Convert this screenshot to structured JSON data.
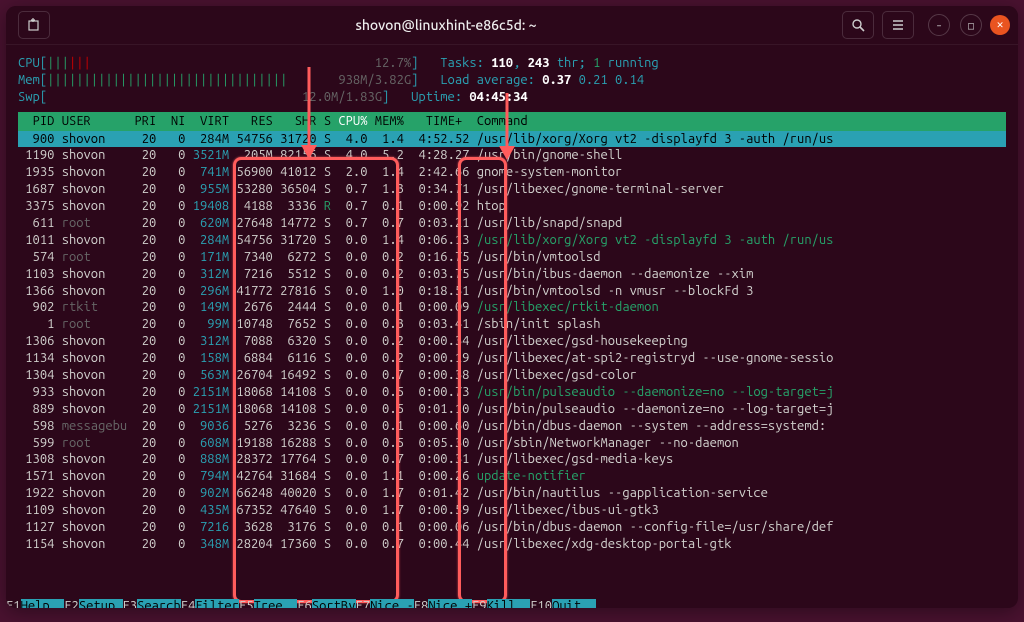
{
  "titlebar": {
    "title": "shovon@linuxhint-e86c5d: ~"
  },
  "meters": {
    "cpu_label": "CPU",
    "cpu_pct": "12.7%",
    "mem_label": "Mem",
    "mem_used": "938M",
    "mem_total": "3.82G",
    "swp_label": "Swp",
    "swp_used": "12.0M",
    "swp_total": "1.83G",
    "tasks_label": "Tasks:",
    "tasks_count": "110",
    "thr_count": "243",
    "thr_label": "thr;",
    "running": "1",
    "running_label": "running",
    "la_label": "Load average:",
    "la1": "0.37",
    "la2": "0.21",
    "la3": "0.14",
    "uptime_label": "Uptime:",
    "uptime": "04:45:34"
  },
  "hdr": {
    "pid": "PID",
    "user": "USER",
    "pri": "PRI",
    "ni": "NI",
    "virt": "VIRT",
    "res": "RES",
    "shr": "SHR",
    "s": "S",
    "cpu": "CPU%",
    "mem": "MEM%",
    "time": "TIME+",
    "cmd": "Command"
  },
  "rows": [
    {
      "pid": "900",
      "user": "shovon",
      "pri": "20",
      "ni": "0",
      "virt": "284M",
      "res": "54756",
      "shr": "31720",
      "s": "S",
      "cpu": "4.0",
      "mem": "1.4",
      "time": "4:52.52",
      "cmd": "/usr/lib/xorg/Xorg vt2 -displayfd 3 -auth /run/us",
      "sel": true
    },
    {
      "pid": "1190",
      "user": "shovon",
      "pri": "20",
      "ni": "0",
      "virt": "3521M",
      "res": "205M",
      "shr": "82156",
      "s": "S",
      "cpu": "4.0",
      "mem": "5.2",
      "time": "4:28.27",
      "cmd": "/usr/bin/gnome-shell"
    },
    {
      "pid": "1935",
      "user": "shovon",
      "pri": "20",
      "ni": "0",
      "virt": "741M",
      "res": "56900",
      "shr": "41012",
      "s": "S",
      "cpu": "2.0",
      "mem": "1.4",
      "time": "2:42.66",
      "cmd": "gnome-system-monitor"
    },
    {
      "pid": "1687",
      "user": "shovon",
      "pri": "20",
      "ni": "0",
      "virt": "955M",
      "res": "53280",
      "shr": "36504",
      "s": "S",
      "cpu": "0.7",
      "mem": "1.3",
      "time": "0:34.71",
      "cmd": "/usr/libexec/gnome-terminal-server"
    },
    {
      "pid": "3375",
      "user": "shovon",
      "pri": "20",
      "ni": "0",
      "virt": "19408",
      "res": "4188",
      "shr": "3336",
      "s": "R",
      "cpu": "0.7",
      "mem": "0.1",
      "time": "0:00.92",
      "cmd": "htop",
      "s_green": true
    },
    {
      "pid": "611",
      "user": "root",
      "user_gray": true,
      "pri": "20",
      "ni": "0",
      "virt": "620M",
      "res": "27648",
      "shr": "14772",
      "s": "S",
      "cpu": "0.7",
      "mem": "0.7",
      "time": "0:03.21",
      "cmd": "/usr/lib/snapd/snapd"
    },
    {
      "pid": "1011",
      "user": "shovon",
      "pri": "20",
      "ni": "0",
      "virt": "284M",
      "res": "54756",
      "shr": "31720",
      "s": "S",
      "cpu": "0.0",
      "mem": "1.4",
      "time": "0:06.13",
      "cmd": "/usr/lib/xorg/Xorg vt2 -displayfd 3 -auth /run/us",
      "cmd_green": true
    },
    {
      "pid": "574",
      "user": "root",
      "user_gray": true,
      "pri": "20",
      "ni": "0",
      "virt": "171M",
      "res": "7340",
      "shr": "6272",
      "s": "S",
      "cpu": "0.0",
      "mem": "0.2",
      "time": "0:16.75",
      "cmd": "/usr/bin/vmtoolsd"
    },
    {
      "pid": "1103",
      "user": "shovon",
      "pri": "20",
      "ni": "0",
      "virt": "312M",
      "res": "7216",
      "shr": "5512",
      "s": "S",
      "cpu": "0.0",
      "mem": "0.2",
      "time": "0:03.75",
      "cmd": "/usr/bin/ibus-daemon --daemonize --xim"
    },
    {
      "pid": "1366",
      "user": "shovon",
      "pri": "20",
      "ni": "0",
      "virt": "296M",
      "res": "41772",
      "shr": "27816",
      "s": "S",
      "cpu": "0.0",
      "mem": "1.0",
      "time": "0:18.51",
      "cmd": "/usr/bin/vmtoolsd -n vmusr --blockFd 3"
    },
    {
      "pid": "902",
      "user": "rtkit",
      "user_gray": true,
      "pri": "20",
      "ni": "0",
      "virt": "149M",
      "res": "2676",
      "shr": "2444",
      "s": "S",
      "cpu": "0.0",
      "mem": "0.1",
      "time": "0:00.09",
      "cmd": "/usr/libexec/rtkit-daemon",
      "cmd_green": true
    },
    {
      "pid": "1",
      "user": "root",
      "user_gray": true,
      "pri": "20",
      "ni": "0",
      "virt": "99M",
      "res": "10748",
      "shr": "7652",
      "s": "S",
      "cpu": "0.0",
      "mem": "0.3",
      "time": "0:03.41",
      "cmd": "/sbin/init splash"
    },
    {
      "pid": "1306",
      "user": "shovon",
      "pri": "20",
      "ni": "0",
      "virt": "312M",
      "res": "7088",
      "shr": "6320",
      "s": "S",
      "cpu": "0.0",
      "mem": "0.2",
      "time": "0:00.34",
      "cmd": "/usr/libexec/gsd-housekeeping"
    },
    {
      "pid": "1134",
      "user": "shovon",
      "pri": "20",
      "ni": "0",
      "virt": "158M",
      "res": "6884",
      "shr": "6116",
      "s": "S",
      "cpu": "0.0",
      "mem": "0.2",
      "time": "0:00.19",
      "cmd": "/usr/libexec/at-spi2-registryd --use-gnome-sessio"
    },
    {
      "pid": "1304",
      "user": "shovon",
      "pri": "20",
      "ni": "0",
      "virt": "563M",
      "res": "26704",
      "shr": "16492",
      "s": "S",
      "cpu": "0.0",
      "mem": "0.7",
      "time": "0:00.38",
      "cmd": "/usr/libexec/gsd-color"
    },
    {
      "pid": "933",
      "user": "shovon",
      "pri": "20",
      "ni": "0",
      "virt": "2151M",
      "res": "18068",
      "shr": "14108",
      "s": "S",
      "cpu": "0.0",
      "mem": "0.5",
      "time": "0:00.73",
      "cmd": "/usr/bin/pulseaudio --daemonize=no --log-target=j",
      "cmd_green": true
    },
    {
      "pid": "889",
      "user": "shovon",
      "pri": "20",
      "ni": "0",
      "virt": "2151M",
      "res": "18068",
      "shr": "14108",
      "s": "S",
      "cpu": "0.0",
      "mem": "0.5",
      "time": "0:01.10",
      "cmd": "/usr/bin/pulseaudio --daemonize=no --log-target=j"
    },
    {
      "pid": "598",
      "user": "messagebu",
      "user_gray": true,
      "pri": "20",
      "ni": "0",
      "virt": "9036",
      "res": "5276",
      "shr": "3236",
      "s": "S",
      "cpu": "0.0",
      "mem": "0.1",
      "time": "0:00.60",
      "cmd": "/usr/bin/dbus-daemon --system --address=systemd:"
    },
    {
      "pid": "599",
      "user": "root",
      "user_gray": true,
      "pri": "20",
      "ni": "0",
      "virt": "608M",
      "res": "19188",
      "shr": "16288",
      "s": "S",
      "cpu": "0.0",
      "mem": "0.5",
      "time": "0:05.30",
      "cmd": "/usr/sbin/NetworkManager --no-daemon"
    },
    {
      "pid": "1308",
      "user": "shovon",
      "pri": "20",
      "ni": "0",
      "virt": "888M",
      "res": "28372",
      "shr": "17764",
      "s": "S",
      "cpu": "0.0",
      "mem": "0.7",
      "time": "0:00.31",
      "cmd": "/usr/libexec/gsd-media-keys"
    },
    {
      "pid": "1571",
      "user": "shovon",
      "pri": "20",
      "ni": "0",
      "virt": "794M",
      "res": "42764",
      "shr": "31684",
      "s": "S",
      "cpu": "0.0",
      "mem": "1.1",
      "time": "0:00.26",
      "cmd": "update-notifier",
      "cmd_green": true
    },
    {
      "pid": "1922",
      "user": "shovon",
      "pri": "20",
      "ni": "0",
      "virt": "902M",
      "res": "66248",
      "shr": "40020",
      "s": "S",
      "cpu": "0.0",
      "mem": "1.7",
      "time": "0:01.42",
      "cmd": "/usr/bin/nautilus --gapplication-service"
    },
    {
      "pid": "1109",
      "user": "shovon",
      "pri": "20",
      "ni": "0",
      "virt": "435M",
      "res": "67352",
      "shr": "47640",
      "s": "S",
      "cpu": "0.0",
      "mem": "1.7",
      "time": "0:00.59",
      "cmd": "/usr/libexec/ibus-ui-gtk3"
    },
    {
      "pid": "1127",
      "user": "shovon",
      "pri": "20",
      "ni": "0",
      "virt": "7216",
      "res": "3628",
      "shr": "3176",
      "s": "S",
      "cpu": "0.0",
      "mem": "0.1",
      "time": "0:00.06",
      "cmd": "/usr/bin/dbus-daemon --config-file=/usr/share/def"
    },
    {
      "pid": "1154",
      "user": "shovon",
      "pri": "20",
      "ni": "0",
      "virt": "348M",
      "res": "28204",
      "shr": "17360",
      "s": "S",
      "cpu": "0.0",
      "mem": "0.7",
      "time": "0:00.44",
      "cmd": "/usr/libexec/xdg-desktop-portal-gtk"
    }
  ],
  "fkeys": {
    "f1": "Help  ",
    "f2": "Setup ",
    "f3": "Search",
    "f4": "Filter",
    "f5": "Tree  ",
    "f6": "SortBy",
    "f7": "Nice -",
    "f8": "Nice +",
    "f9": "Kill  ",
    "f10": "Quit  "
  }
}
